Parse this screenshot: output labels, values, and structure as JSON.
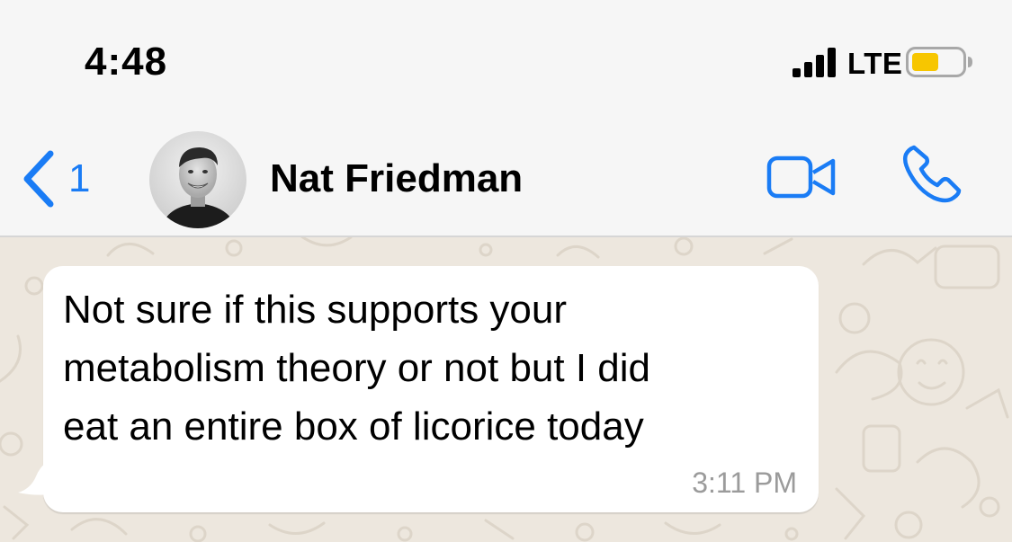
{
  "status_bar": {
    "time": "4:48",
    "network": "LTE",
    "icons": [
      "signal-icon",
      "battery-icon"
    ],
    "battery_color": "#f7c600"
  },
  "nav": {
    "back_count": "1",
    "contact_name": "Nat Friedman",
    "icons": [
      "back-chevron-icon",
      "video-camera-icon",
      "phone-icon"
    ],
    "accent_color": "#1a7cf5"
  },
  "chat": {
    "messages": [
      {
        "direction": "incoming",
        "lines": [
          "Not sure if this supports your",
          "metabolism theory or not but I did",
          "eat an entire box of licorice today"
        ],
        "time": "3:11 PM"
      }
    ]
  }
}
